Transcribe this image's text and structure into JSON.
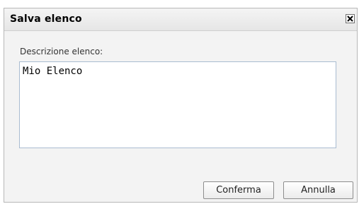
{
  "dialog": {
    "title": "Salva elenco",
    "close_icon": "close-icon"
  },
  "form": {
    "description_label": "Descrizione elenco:",
    "description_value": "Mio Elenco"
  },
  "buttons": {
    "confirm_label": "Conferma",
    "cancel_label": "Annulla"
  }
}
